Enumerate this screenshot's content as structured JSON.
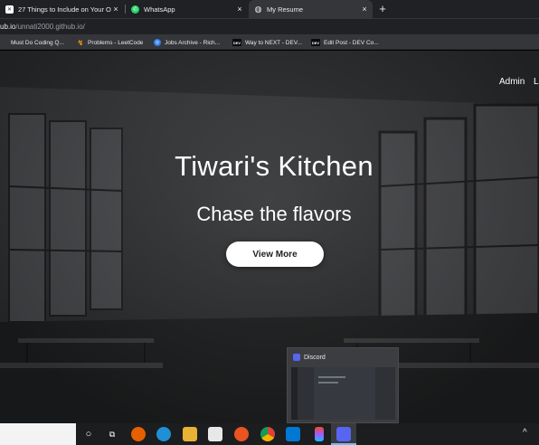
{
  "browser": {
    "tabs": [
      {
        "title": "27 Things to Include on Your Onl",
        "icon": "document-favicon-icon",
        "active": false
      },
      {
        "title": "WhatsApp",
        "icon": "whatsapp-icon",
        "active": false
      },
      {
        "title": "My Resume",
        "icon": "globe-icon",
        "active": true
      }
    ],
    "close_glyph": "×",
    "new_tab_glyph": "+",
    "address": {
      "host": "ub.io",
      "path": "/unnati2000.github.io/"
    },
    "bookmarks": [
      {
        "label": "Must Do Coding Q...",
        "icon": "bookmark-page-icon"
      },
      {
        "label": "Problems - LeetCode",
        "icon": "leetcode-icon"
      },
      {
        "label": "Jobs Archive - Rich...",
        "icon": "jobs-site-icon"
      },
      {
        "label": "Way to NEXT - DEV...",
        "icon": "dev-icon",
        "badge": "DEV"
      },
      {
        "label": "Edit Post - DEV Co...",
        "icon": "dev-icon",
        "badge": "DEV"
      }
    ]
  },
  "site": {
    "nav": {
      "admin": "Admin",
      "next_partial": "L"
    },
    "hero": {
      "title": "Tiwari's Kitchen",
      "subtitle": "Chase the flavors",
      "cta": "View More"
    }
  },
  "discord_preview": {
    "title": "Discord"
  },
  "taskbar": {
    "icons": [
      "cortana-icon",
      "task-view-icon",
      "firefox-icon",
      "edge-icon",
      "file-explorer-icon",
      "store-icon",
      "ubuntu-icon",
      "chrome-icon",
      "mail-icon",
      "figma-icon",
      "discord-icon"
    ],
    "tray_glyph": "^"
  },
  "colors": {
    "tab_strip": "#202124",
    "toolbar": "#35363a",
    "whatsapp": "#25d366",
    "discord": "#5865f2",
    "cta_background": "#ffffff"
  }
}
